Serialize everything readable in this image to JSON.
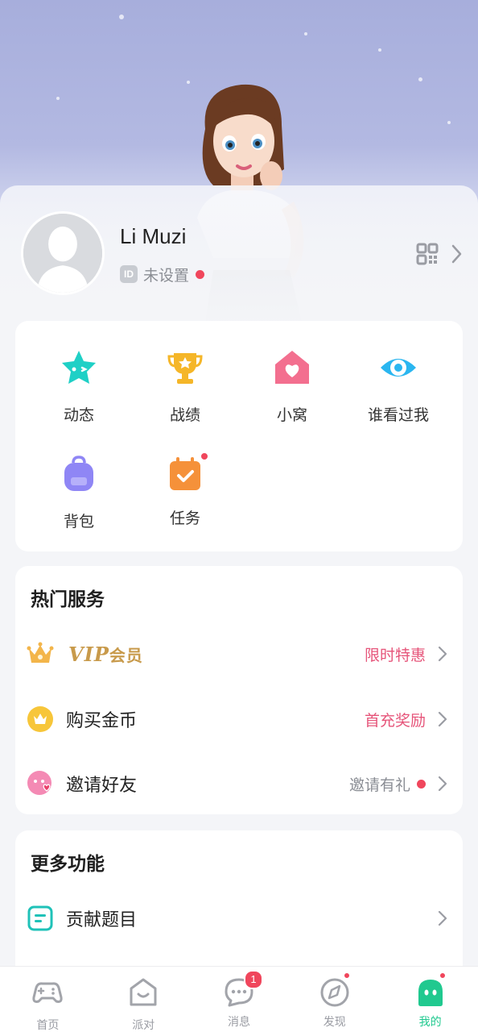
{
  "profile": {
    "username": "Li Muzi",
    "id_badge": "ID",
    "id_value": "未设置",
    "qr_icon": "qr-code-icon"
  },
  "quick_grid": [
    {
      "label": "动态",
      "icon": "star-face-icon",
      "color": "#1fd0c6",
      "dot": false
    },
    {
      "label": "战绩",
      "icon": "trophy-icon",
      "color": "#f5b628",
      "dot": false
    },
    {
      "label": "小窝",
      "icon": "home-heart-icon",
      "color": "#f36f8f",
      "dot": false
    },
    {
      "label": "谁看过我",
      "icon": "eye-icon",
      "color": "#2ab6f0",
      "dot": false
    },
    {
      "label": "背包",
      "icon": "backpack-icon",
      "color": "#8f86f5",
      "dot": false
    },
    {
      "label": "任务",
      "icon": "calendar-check-icon",
      "color": "#f5913a",
      "dot": true
    }
  ],
  "services": {
    "title": "热门服务",
    "vip": {
      "label_main": "VIP",
      "label_sub": "会员",
      "right": "限时特惠",
      "icon": "crown-icon"
    },
    "coins": {
      "label": "购买金币",
      "right": "首充奖励",
      "icon": "coin-crown-icon"
    },
    "invite": {
      "label": "邀请好友",
      "right": "邀请有礼",
      "icon": "invite-face-icon"
    }
  },
  "more": {
    "title": "更多功能",
    "contribute": {
      "label": "贡献题目",
      "icon": "note-icon"
    }
  },
  "nav": [
    {
      "label": "首页",
      "icon": "gamepad-icon",
      "badge": "",
      "dot": false,
      "active": false
    },
    {
      "label": "派对",
      "icon": "party-house-icon",
      "badge": "",
      "dot": false,
      "active": false
    },
    {
      "label": "消息",
      "icon": "chat-icon",
      "badge": "1",
      "dot": false,
      "active": false
    },
    {
      "label": "发现",
      "icon": "compass-icon",
      "badge": "",
      "dot": true,
      "active": false
    },
    {
      "label": "我的",
      "icon": "me-icon",
      "badge": "",
      "dot": true,
      "active": true
    }
  ],
  "colors": {
    "accent_green": "#20c98f",
    "badge_red": "#f0465c",
    "promo_pink": "#e6557a",
    "vip_gold": "#c89a4b"
  }
}
